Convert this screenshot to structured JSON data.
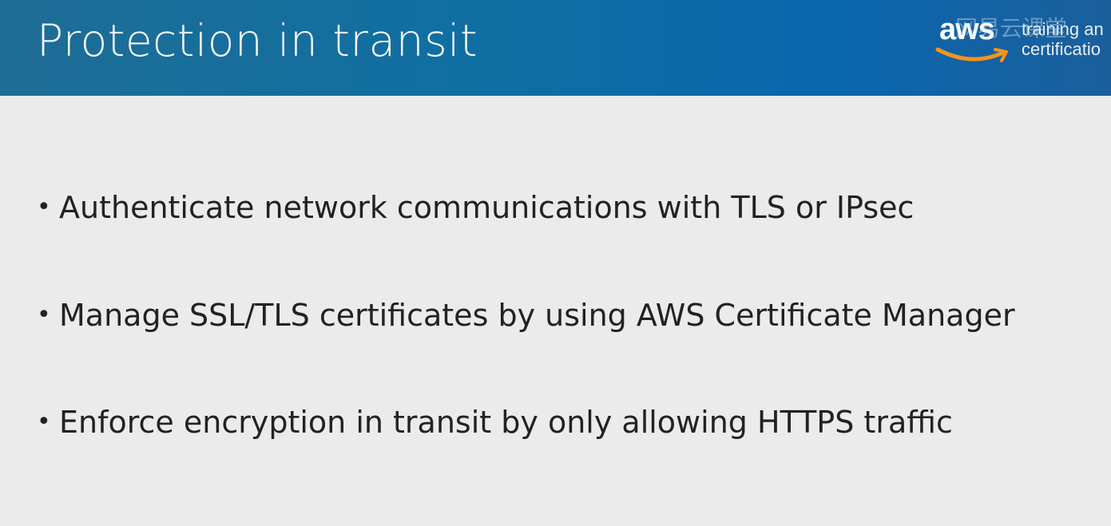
{
  "slide": {
    "title": "Protection in transit",
    "bullets": [
      "Authenticate network communications with TLS or IPsec",
      "Manage SSL/TLS certificates by using AWS Certificate Manager",
      "Enforce encryption in transit by only allowing HTTPS traffic"
    ],
    "bullet_symbol": "•"
  },
  "logo": {
    "word": "aws",
    "line1": "training an",
    "line2": "certificatio",
    "smile_color": "#f7931e"
  },
  "watermark": {
    "text": "网易云课堂"
  },
  "colors": {
    "header": "#0f6fa3",
    "background": "#ebebeb",
    "text": "#222222"
  }
}
